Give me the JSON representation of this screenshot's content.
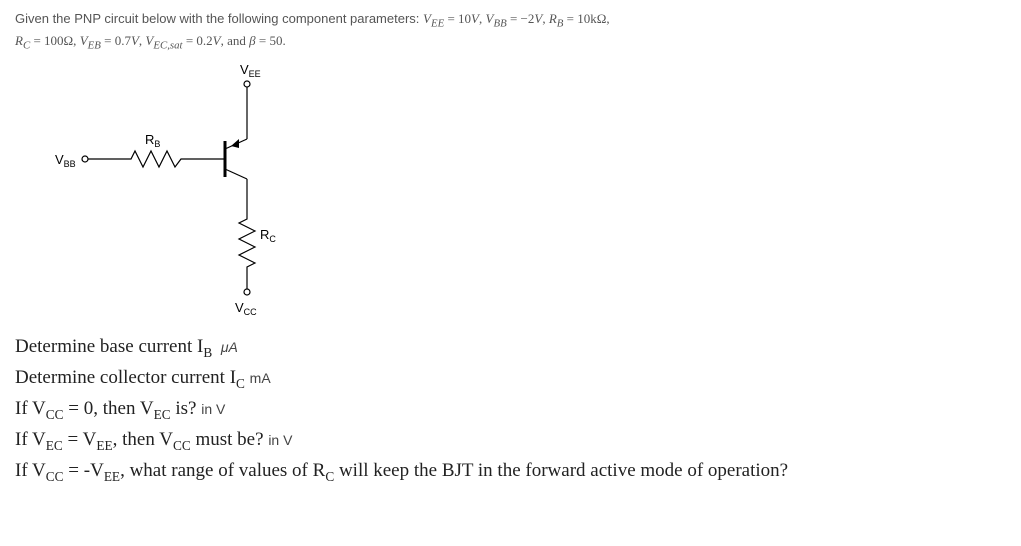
{
  "problem": {
    "intro": "Given the PNP circuit below with the following component parameters: ",
    "params_line1_html": "V<sub>EE</sub> = 10V, V<sub>BB</sub> = −2V, R<sub>B</sub> = 10kΩ,",
    "params_line2_html": "R<sub>C</sub> = 100Ω, V<sub>EB</sub> = 0.7V, V<sub>EC,sat</sub> = 0.2V, and β = 50."
  },
  "circuit": {
    "labels": {
      "VEE": "V",
      "VEE_sub": "EE",
      "VBB": "V",
      "VBB_sub": "BB",
      "RB": "R",
      "RB_sub": "B",
      "RC": "R",
      "RC_sub": "C",
      "VCC": "V",
      "VCC_sub": "CC"
    }
  },
  "questions": {
    "q1_pre": "Determine base current I",
    "q1_sub": "B",
    "q1_unit": "μA",
    "q2_pre": "Determine collector current I",
    "q2_sub": "C",
    "q2_unit": "mA",
    "q3_pre": "If V",
    "q3_sub1": "CC",
    "q3_mid": " = 0, then V",
    "q3_sub2": "EC",
    "q3_post": " is?",
    "q3_unit": "in V",
    "q4_pre": "If V",
    "q4_sub1": "EC",
    "q4_mid": " = V",
    "q4_sub2": "EE",
    "q4_mid2": ", then V",
    "q4_sub3": "CC",
    "q4_post": " must be?",
    "q4_unit": "in V",
    "q5_pre": "If V",
    "q5_sub1": "CC",
    "q5_mid": " = -V",
    "q5_sub2": "EE",
    "q5_mid2": ", what range of values of R",
    "q5_sub3": "C",
    "q5_post": " will keep the BJT in the forward active mode of operation?"
  }
}
